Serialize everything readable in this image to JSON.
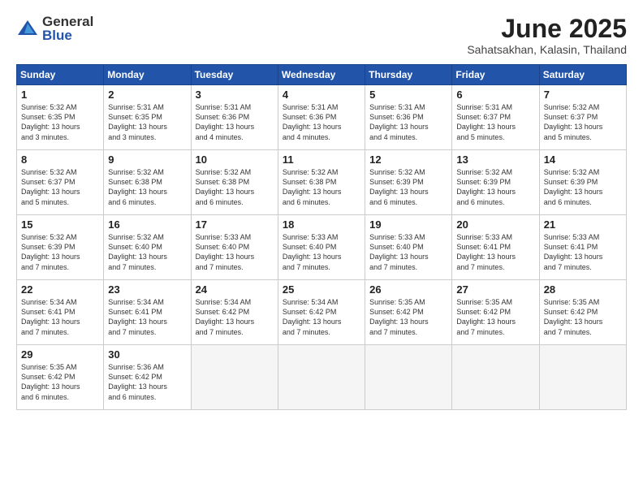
{
  "header": {
    "logo_general": "General",
    "logo_blue": "Blue",
    "month_title": "June 2025",
    "location": "Sahatsakhan, Kalasin, Thailand"
  },
  "weekdays": [
    "Sunday",
    "Monday",
    "Tuesday",
    "Wednesday",
    "Thursday",
    "Friday",
    "Saturday"
  ],
  "weeks": [
    [
      {
        "day": "1",
        "info": "Sunrise: 5:32 AM\nSunset: 6:35 PM\nDaylight: 13 hours\nand 3 minutes."
      },
      {
        "day": "2",
        "info": "Sunrise: 5:31 AM\nSunset: 6:35 PM\nDaylight: 13 hours\nand 3 minutes."
      },
      {
        "day": "3",
        "info": "Sunrise: 5:31 AM\nSunset: 6:36 PM\nDaylight: 13 hours\nand 4 minutes."
      },
      {
        "day": "4",
        "info": "Sunrise: 5:31 AM\nSunset: 6:36 PM\nDaylight: 13 hours\nand 4 minutes."
      },
      {
        "day": "5",
        "info": "Sunrise: 5:31 AM\nSunset: 6:36 PM\nDaylight: 13 hours\nand 4 minutes."
      },
      {
        "day": "6",
        "info": "Sunrise: 5:31 AM\nSunset: 6:37 PM\nDaylight: 13 hours\nand 5 minutes."
      },
      {
        "day": "7",
        "info": "Sunrise: 5:32 AM\nSunset: 6:37 PM\nDaylight: 13 hours\nand 5 minutes."
      }
    ],
    [
      {
        "day": "8",
        "info": "Sunrise: 5:32 AM\nSunset: 6:37 PM\nDaylight: 13 hours\nand 5 minutes."
      },
      {
        "day": "9",
        "info": "Sunrise: 5:32 AM\nSunset: 6:38 PM\nDaylight: 13 hours\nand 6 minutes."
      },
      {
        "day": "10",
        "info": "Sunrise: 5:32 AM\nSunset: 6:38 PM\nDaylight: 13 hours\nand 6 minutes."
      },
      {
        "day": "11",
        "info": "Sunrise: 5:32 AM\nSunset: 6:38 PM\nDaylight: 13 hours\nand 6 minutes."
      },
      {
        "day": "12",
        "info": "Sunrise: 5:32 AM\nSunset: 6:39 PM\nDaylight: 13 hours\nand 6 minutes."
      },
      {
        "day": "13",
        "info": "Sunrise: 5:32 AM\nSunset: 6:39 PM\nDaylight: 13 hours\nand 6 minutes."
      },
      {
        "day": "14",
        "info": "Sunrise: 5:32 AM\nSunset: 6:39 PM\nDaylight: 13 hours\nand 6 minutes."
      }
    ],
    [
      {
        "day": "15",
        "info": "Sunrise: 5:32 AM\nSunset: 6:39 PM\nDaylight: 13 hours\nand 7 minutes."
      },
      {
        "day": "16",
        "info": "Sunrise: 5:32 AM\nSunset: 6:40 PM\nDaylight: 13 hours\nand 7 minutes."
      },
      {
        "day": "17",
        "info": "Sunrise: 5:33 AM\nSunset: 6:40 PM\nDaylight: 13 hours\nand 7 minutes."
      },
      {
        "day": "18",
        "info": "Sunrise: 5:33 AM\nSunset: 6:40 PM\nDaylight: 13 hours\nand 7 minutes."
      },
      {
        "day": "19",
        "info": "Sunrise: 5:33 AM\nSunset: 6:40 PM\nDaylight: 13 hours\nand 7 minutes."
      },
      {
        "day": "20",
        "info": "Sunrise: 5:33 AM\nSunset: 6:41 PM\nDaylight: 13 hours\nand 7 minutes."
      },
      {
        "day": "21",
        "info": "Sunrise: 5:33 AM\nSunset: 6:41 PM\nDaylight: 13 hours\nand 7 minutes."
      }
    ],
    [
      {
        "day": "22",
        "info": "Sunrise: 5:34 AM\nSunset: 6:41 PM\nDaylight: 13 hours\nand 7 minutes."
      },
      {
        "day": "23",
        "info": "Sunrise: 5:34 AM\nSunset: 6:41 PM\nDaylight: 13 hours\nand 7 minutes."
      },
      {
        "day": "24",
        "info": "Sunrise: 5:34 AM\nSunset: 6:42 PM\nDaylight: 13 hours\nand 7 minutes."
      },
      {
        "day": "25",
        "info": "Sunrise: 5:34 AM\nSunset: 6:42 PM\nDaylight: 13 hours\nand 7 minutes."
      },
      {
        "day": "26",
        "info": "Sunrise: 5:35 AM\nSunset: 6:42 PM\nDaylight: 13 hours\nand 7 minutes."
      },
      {
        "day": "27",
        "info": "Sunrise: 5:35 AM\nSunset: 6:42 PM\nDaylight: 13 hours\nand 7 minutes."
      },
      {
        "day": "28",
        "info": "Sunrise: 5:35 AM\nSunset: 6:42 PM\nDaylight: 13 hours\nand 7 minutes."
      }
    ],
    [
      {
        "day": "29",
        "info": "Sunrise: 5:35 AM\nSunset: 6:42 PM\nDaylight: 13 hours\nand 6 minutes."
      },
      {
        "day": "30",
        "info": "Sunrise: 5:36 AM\nSunset: 6:42 PM\nDaylight: 13 hours\nand 6 minutes."
      },
      {
        "day": "",
        "info": ""
      },
      {
        "day": "",
        "info": ""
      },
      {
        "day": "",
        "info": ""
      },
      {
        "day": "",
        "info": ""
      },
      {
        "day": "",
        "info": ""
      }
    ]
  ]
}
